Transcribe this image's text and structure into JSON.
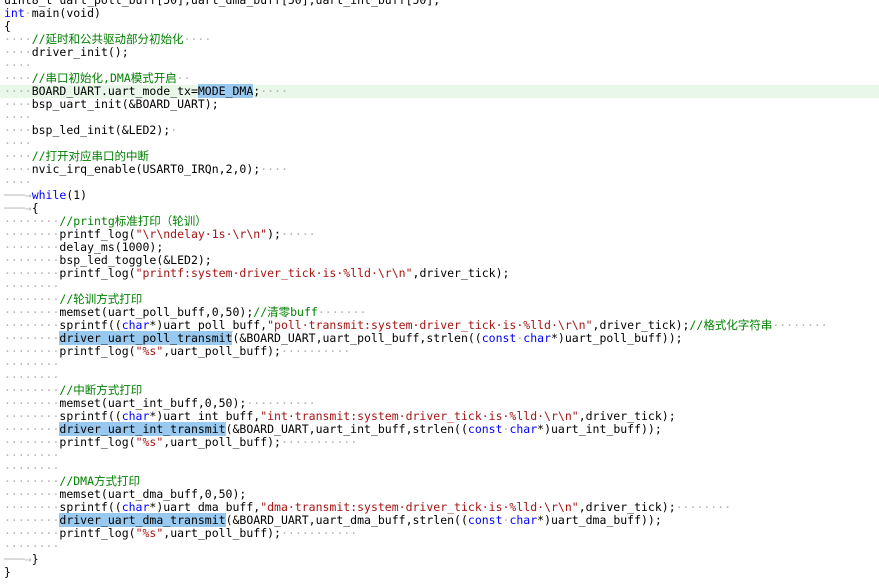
{
  "editor": {
    "colors": {
      "background": "#ffffff",
      "text": "#000000",
      "keyword": "#0000ff",
      "comment": "#008000",
      "string": "#a31515",
      "whitespace_marker": "#b4b4b4",
      "selection_highlight": "#99c9ef",
      "current_line": "#e8f7e8"
    },
    "current_line_index": 7,
    "lines": [
      [
        [
          "p",
          "uint8_t uart_poll_buff[50],uart_dma_buff[50],uart_int_buff[50];"
        ]
      ],
      [
        [
          "k",
          "int"
        ],
        [
          "w",
          "·"
        ],
        [
          "p",
          "main(void)"
        ]
      ],
      [
        [
          "p",
          "{"
        ]
      ],
      [
        [
          "w",
          "····"
        ],
        [
          "c",
          "//延时和公共驱动部分初始化"
        ],
        [
          "w",
          "····"
        ]
      ],
      [
        [
          "w",
          "····"
        ],
        [
          "p",
          "driver_init();"
        ]
      ],
      [
        [
          "w",
          "····"
        ]
      ],
      [
        [
          "w",
          "····"
        ],
        [
          "c",
          "//串口初始化,DMA模式开启"
        ],
        [
          "w",
          "··"
        ]
      ],
      [
        [
          "w",
          "····"
        ],
        [
          "p",
          "BOARD_UART.uart_mode_tx="
        ],
        [
          "h",
          "MODE_DMA"
        ],
        [
          "p",
          ";"
        ],
        [
          "w",
          "····"
        ]
      ],
      [
        [
          "w",
          "····"
        ],
        [
          "p",
          "bsp_uart_init(&BOARD_UART);"
        ]
      ],
      [
        [
          "w",
          "····"
        ]
      ],
      [
        [
          "w",
          "····"
        ],
        [
          "p",
          "bsp_led_init(&LED2);"
        ],
        [
          "w",
          "·"
        ]
      ],
      [
        [
          "w",
          "····"
        ]
      ],
      [
        [
          "w",
          "····"
        ],
        [
          "c",
          "//打开对应串口的中断"
        ]
      ],
      [
        [
          "w",
          "····"
        ],
        [
          "p",
          "nvic_irq_enable(USART0_IRQn,2,0);"
        ],
        [
          "w",
          "····"
        ]
      ],
      [
        [
          "w",
          "····"
        ]
      ],
      [
        [
          "w",
          "───→"
        ],
        [
          "k",
          "while"
        ],
        [
          "p",
          "(1)"
        ]
      ],
      [
        [
          "w",
          "───→"
        ],
        [
          "p",
          "{"
        ]
      ],
      [
        [
          "w",
          "········"
        ],
        [
          "c",
          "//printg标准打印（轮训）"
        ]
      ],
      [
        [
          "w",
          "········"
        ],
        [
          "p",
          "printf_log("
        ],
        [
          "s",
          "\"\\r\\ndelay·1s·\\r\\n\""
        ],
        [
          "p",
          ");"
        ],
        [
          "w",
          "·····"
        ]
      ],
      [
        [
          "w",
          "········"
        ],
        [
          "p",
          "delay_ms(1000);"
        ]
      ],
      [
        [
          "w",
          "········"
        ],
        [
          "p",
          "bsp_led_toggle(&LED2);"
        ]
      ],
      [
        [
          "w",
          "········"
        ],
        [
          "p",
          "printf_log("
        ],
        [
          "s",
          "\"printf:system·driver_tick·is·%lld·\\r\\n\""
        ],
        [
          "p",
          ",driver_tick);"
        ]
      ],
      [
        [
          "w",
          "········"
        ]
      ],
      [
        [
          "w",
          "········"
        ],
        [
          "c",
          "//轮训方式打印"
        ]
      ],
      [
        [
          "w",
          "········"
        ],
        [
          "p",
          "memset(uart_poll_buff,0,50);"
        ],
        [
          "c",
          "//清零buff"
        ],
        [
          "w",
          "·······"
        ]
      ],
      [
        [
          "w",
          "········"
        ],
        [
          "p",
          "sprintf(("
        ],
        [
          "k",
          "char"
        ],
        [
          "p",
          "*)uart_poll_buff,"
        ],
        [
          "s",
          "\"poll·transmit:system·driver_tick·is·%lld·\\r\\n\""
        ],
        [
          "p",
          ",driver_tick);"
        ],
        [
          "c",
          "//格式化字符串"
        ],
        [
          "w",
          "········"
        ]
      ],
      [
        [
          "w",
          "········"
        ],
        [
          "h",
          "driver_uart_poll_transmit"
        ],
        [
          "p",
          "(&BOARD_UART,uart_poll_buff,strlen(("
        ],
        [
          "k",
          "const"
        ],
        [
          "w",
          "·"
        ],
        [
          "k",
          "char"
        ],
        [
          "p",
          "*)uart_poll_buff));"
        ]
      ],
      [
        [
          "w",
          "········"
        ],
        [
          "p",
          "printf_log("
        ],
        [
          "s",
          "\"%s\""
        ],
        [
          "p",
          ",uart_poll_buff);"
        ],
        [
          "w",
          "··········"
        ]
      ],
      [
        [
          "w",
          "········"
        ]
      ],
      [
        [
          "w",
          "········"
        ]
      ],
      [
        [
          "w",
          "········"
        ],
        [
          "c",
          "//中断方式打印"
        ]
      ],
      [
        [
          "w",
          "········"
        ],
        [
          "p",
          "memset(uart_int_buff,0,50);"
        ],
        [
          "w",
          "··········"
        ]
      ],
      [
        [
          "w",
          "········"
        ],
        [
          "p",
          "sprintf(("
        ],
        [
          "k",
          "char"
        ],
        [
          "p",
          "*)uart_int_buff,"
        ],
        [
          "s",
          "\"int·transmit:system·driver_tick·is·%lld·\\r\\n\""
        ],
        [
          "p",
          ",driver_tick);"
        ]
      ],
      [
        [
          "w",
          "········"
        ],
        [
          "h",
          "driver_uart_int_transmit"
        ],
        [
          "p",
          "(&BOARD_UART,uart_int_buff,strlen(("
        ],
        [
          "k",
          "const"
        ],
        [
          "w",
          "·"
        ],
        [
          "k",
          "char"
        ],
        [
          "p",
          "*)uart_int_buff));"
        ]
      ],
      [
        [
          "w",
          "········"
        ],
        [
          "p",
          "printf_log("
        ],
        [
          "s",
          "\"%s\""
        ],
        [
          "p",
          ",uart_poll_buff);"
        ],
        [
          "w",
          "···········"
        ]
      ],
      [
        [
          "w",
          "········"
        ]
      ],
      [
        [
          "w",
          "········"
        ]
      ],
      [
        [
          "w",
          "········"
        ],
        [
          "c",
          "//DMA方式打印"
        ]
      ],
      [
        [
          "w",
          "········"
        ],
        [
          "p",
          "memset(uart_dma_buff,0,50);"
        ]
      ],
      [
        [
          "w",
          "········"
        ],
        [
          "p",
          "sprintf(("
        ],
        [
          "k",
          "char"
        ],
        [
          "p",
          "*)uart_dma_buff,"
        ],
        [
          "s",
          "\"dma·transmit:system·driver_tick·is·%lld·\\r\\n\""
        ],
        [
          "p",
          ",driver_tick);"
        ],
        [
          "w",
          "········"
        ]
      ],
      [
        [
          "w",
          "········"
        ],
        [
          "h",
          "driver_uart_dma_transmit"
        ],
        [
          "p",
          "(&BOARD_UART,uart_dma_buff,strlen(("
        ],
        [
          "k",
          "const"
        ],
        [
          "w",
          "·"
        ],
        [
          "k",
          "char"
        ],
        [
          "p",
          "*)uart_dma_buff));"
        ]
      ],
      [
        [
          "w",
          "········"
        ],
        [
          "p",
          "printf_log("
        ],
        [
          "s",
          "\"%s\""
        ],
        [
          "p",
          ",uart_poll_buff);"
        ],
        [
          "w",
          "···········"
        ]
      ],
      [
        [
          "w",
          "········"
        ]
      ],
      [
        [
          "w",
          "───→"
        ],
        [
          "p",
          "}"
        ]
      ],
      [
        [
          "p",
          "}"
        ]
      ]
    ]
  }
}
